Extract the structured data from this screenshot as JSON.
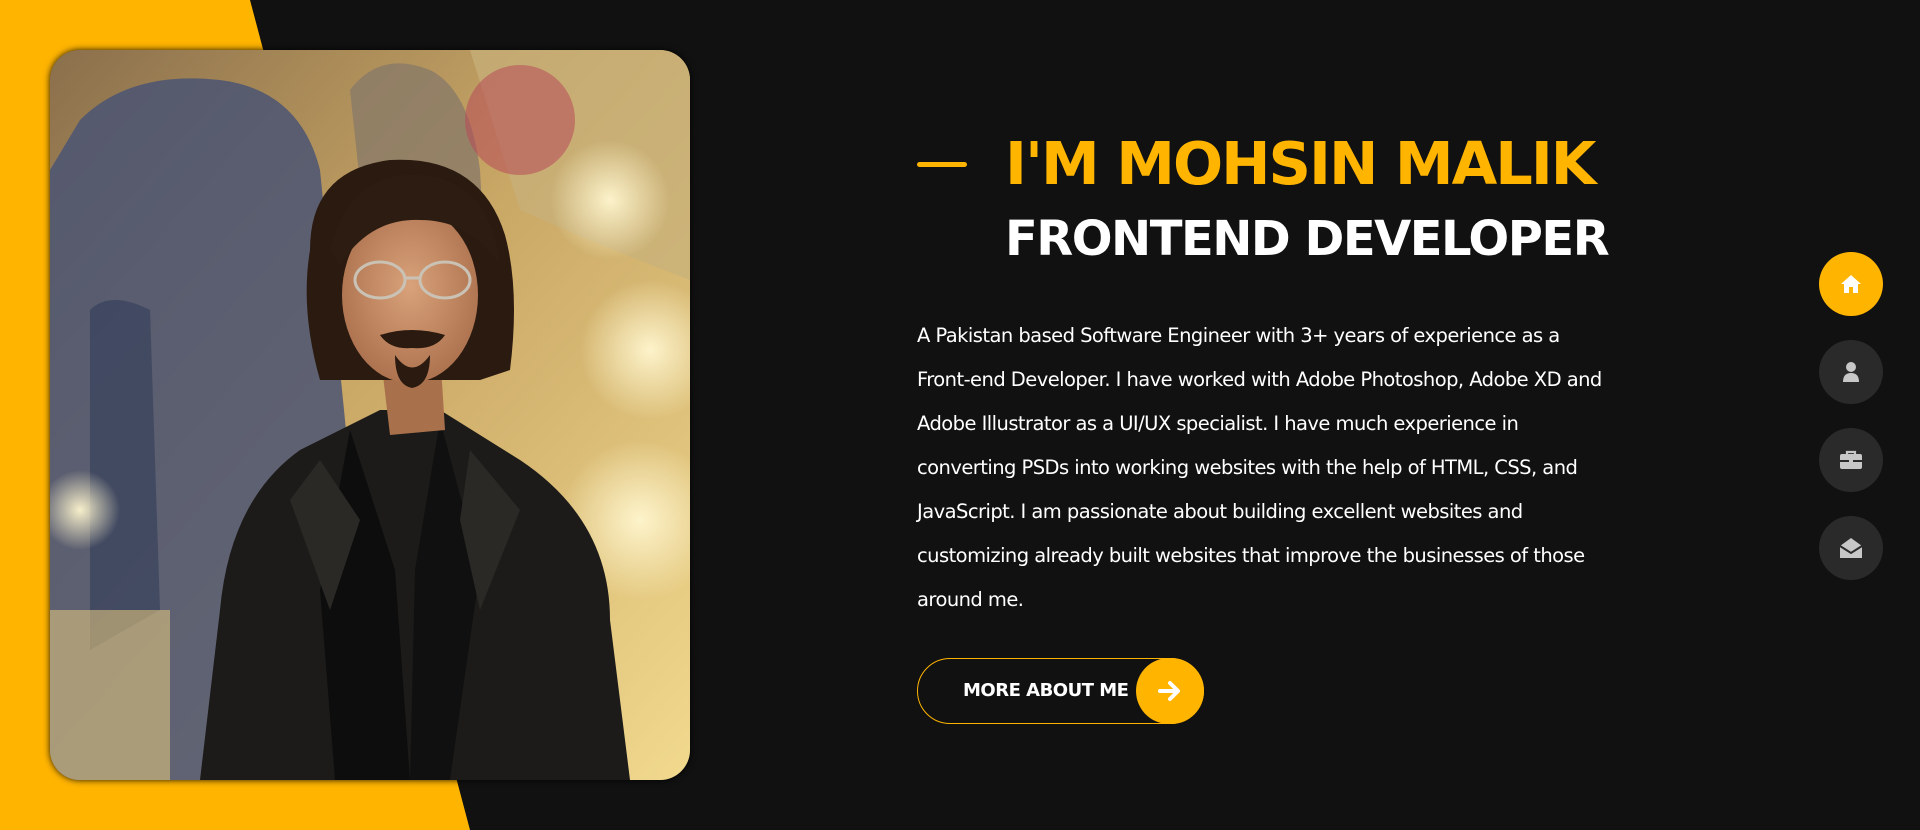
{
  "hero": {
    "name_heading": "I'M MOHSIN MALIK",
    "role_heading": "FRONTEND DEVELOPER",
    "bio": "A Pakistan based Software Engineer with 3+ years of experience as a Front-end Developer. I have worked with Adobe Photoshop, Adobe XD and Adobe Illustrator as a UI/UX specialist. I have much experience in converting PSDs into working websites with the help of HTML, CSS, and JavaScript. I am passionate about building excellent websites and customizing already built websites that improve the businesses of those around me.",
    "cta_label": "MORE ABOUT ME",
    "cta_icon": "arrow-right-icon"
  },
  "side_nav": {
    "items": [
      {
        "icon": "home-icon",
        "active": true
      },
      {
        "icon": "user-icon",
        "active": false
      },
      {
        "icon": "briefcase-icon",
        "active": false
      },
      {
        "icon": "envelope-open-icon",
        "active": false
      }
    ]
  },
  "colors": {
    "accent": "#ffb400",
    "background": "#111111",
    "nav_inactive": "#2b2a2a",
    "text": "#ffffff"
  }
}
